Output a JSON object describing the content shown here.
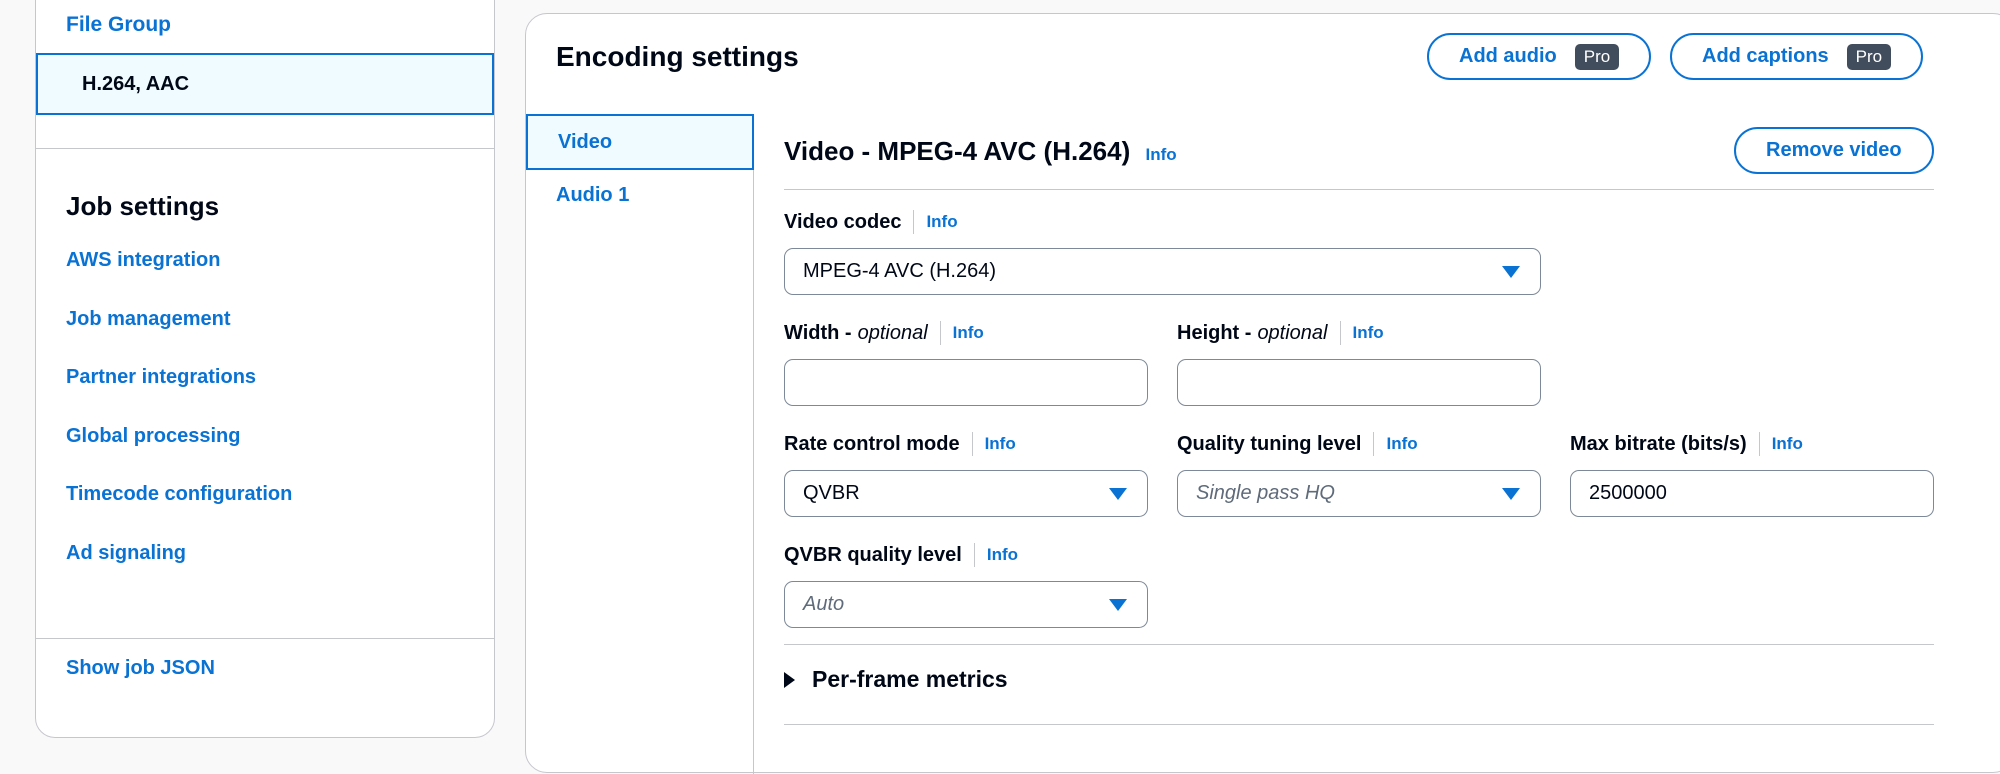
{
  "sidebar": {
    "file_group_label": "File Group",
    "selected_output": "H.264, AAC",
    "job_settings_title": "Job settings",
    "nav_items": [
      "AWS integration",
      "Job management",
      "Partner integrations",
      "Global processing",
      "Timecode configuration",
      "Ad signaling"
    ],
    "show_json_label": "Show job JSON"
  },
  "encoding": {
    "title": "Encoding settings",
    "add_audio_label": "Add audio",
    "add_captions_label": "Add captions",
    "pro_badge": "Pro",
    "tabs": [
      "Video",
      "Audio 1"
    ],
    "video": {
      "title": "Video - MPEG-4 AVC (H.264)",
      "info_label": "Info",
      "remove_label": "Remove video",
      "fields": {
        "codec": {
          "label": "Video codec",
          "value": "MPEG-4 AVC (H.264)"
        },
        "width": {
          "label": "Width - ",
          "optional": "optional",
          "value": ""
        },
        "height": {
          "label": "Height - ",
          "optional": "optional",
          "value": ""
        },
        "rate_control": {
          "label": "Rate control mode",
          "value": "QVBR"
        },
        "quality_tuning": {
          "label": "Quality tuning level",
          "placeholder": "Single pass HQ"
        },
        "max_bitrate": {
          "label": "Max bitrate (bits/s)",
          "value": "2500000"
        },
        "qvbr_quality": {
          "label": "QVBR quality level",
          "placeholder": "Auto"
        }
      },
      "per_frame_metrics_label": "Per-frame metrics"
    }
  },
  "icons": {
    "dropdown": "caret-down-icon",
    "expand": "caret-right-icon"
  },
  "colors": {
    "accent": "#0972d3",
    "selected_bg": "#f0fbff",
    "text": "#000716",
    "badge_bg": "#414d5c",
    "border": "#c6c6cd"
  }
}
